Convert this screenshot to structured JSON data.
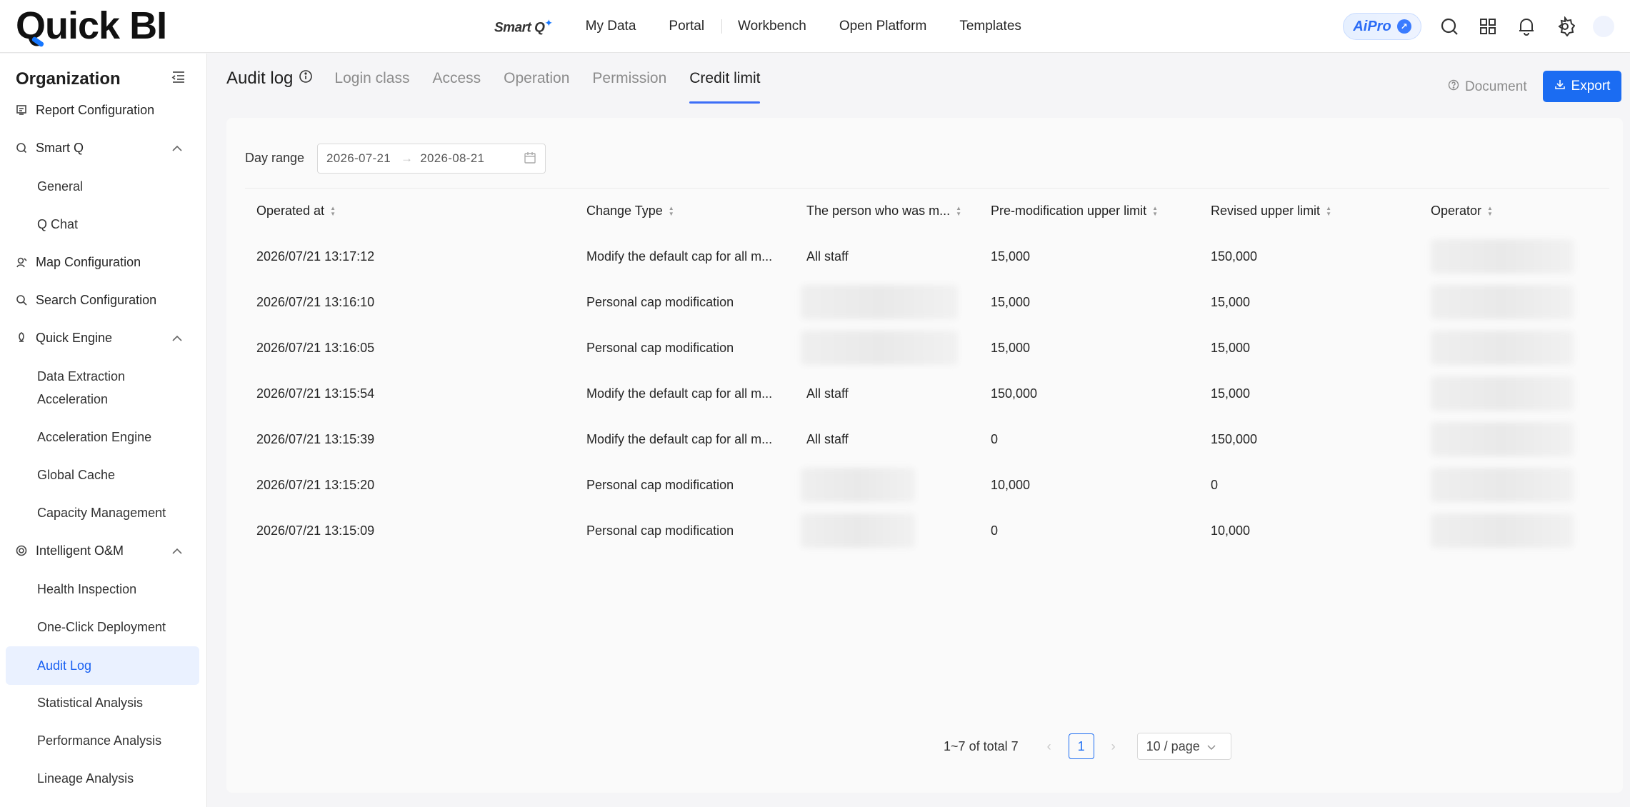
{
  "app": {
    "logo": "Quick BI"
  },
  "topnav": {
    "smartq": "Smart Q",
    "items": [
      "My Data",
      "Portal",
      "Workbench",
      "Open Platform",
      "Templates"
    ],
    "aipro": "AiPro"
  },
  "sidebar": {
    "title": "Organization",
    "items": [
      {
        "label": "Report Configuration"
      },
      {
        "label": "Smart Q"
      },
      {
        "label": "General"
      },
      {
        "label": "Q Chat"
      },
      {
        "label": "Map Configuration"
      },
      {
        "label": "Search Configuration"
      },
      {
        "label": "Quick Engine"
      },
      {
        "label_line1": "Data Extraction",
        "label_line2": "Acceleration"
      },
      {
        "label": "Acceleration Engine"
      },
      {
        "label": "Global Cache"
      },
      {
        "label": "Capacity Management"
      },
      {
        "label": "Intelligent O&M"
      },
      {
        "label": "Health Inspection"
      },
      {
        "label": "One-Click Deployment"
      },
      {
        "label": "Audit Log"
      },
      {
        "label": "Statistical Analysis"
      },
      {
        "label": "Performance Analysis"
      },
      {
        "label": "Lineage Analysis"
      }
    ]
  },
  "main": {
    "title": "Audit log",
    "tabs": [
      "Login class",
      "Access",
      "Operation",
      "Permission",
      "Credit limit"
    ],
    "active_tab": "Credit limit",
    "document_label": "Document",
    "export_label": "Export",
    "filter": {
      "label": "Day range",
      "start": "2026-07-21",
      "end": "2026-08-21"
    },
    "table": {
      "columns": [
        "Operated at",
        "Change Type",
        "The person who was m...",
        "Pre-modification upper limit",
        "Revised upper limit",
        "Operator"
      ],
      "rows": [
        {
          "time": "2026/07/21 13:17:12",
          "type": "Modify the default cap for all m...",
          "person": "All staff",
          "pre": "15,000",
          "revised": "150,000"
        },
        {
          "time": "2026/07/21 13:16:10",
          "type": "Personal cap modification",
          "person": "",
          "pre": "15,000",
          "revised": "15,000"
        },
        {
          "time": "2026/07/21 13:16:05",
          "type": "Personal cap modification",
          "person": "",
          "pre": "15,000",
          "revised": "15,000"
        },
        {
          "time": "2026/07/21 13:15:54",
          "type": "Modify the default cap for all m...",
          "person": "All staff",
          "pre": "150,000",
          "revised": "15,000"
        },
        {
          "time": "2026/07/21 13:15:39",
          "type": "Modify the default cap for all m...",
          "person": "All staff",
          "pre": "0",
          "revised": "150,000"
        },
        {
          "time": "2026/07/21 13:15:20",
          "type": "Personal cap modification",
          "person": "",
          "pre": "10,000",
          "revised": "0"
        },
        {
          "time": "2026/07/21 13:15:09",
          "type": "Personal cap modification",
          "person": "",
          "pre": "0",
          "revised": "10,000"
        }
      ]
    },
    "pagination": {
      "range": "1~7",
      "of_label": "of",
      "total_label": "total",
      "total": "7",
      "current": "1",
      "page_size": "10 / page"
    }
  }
}
